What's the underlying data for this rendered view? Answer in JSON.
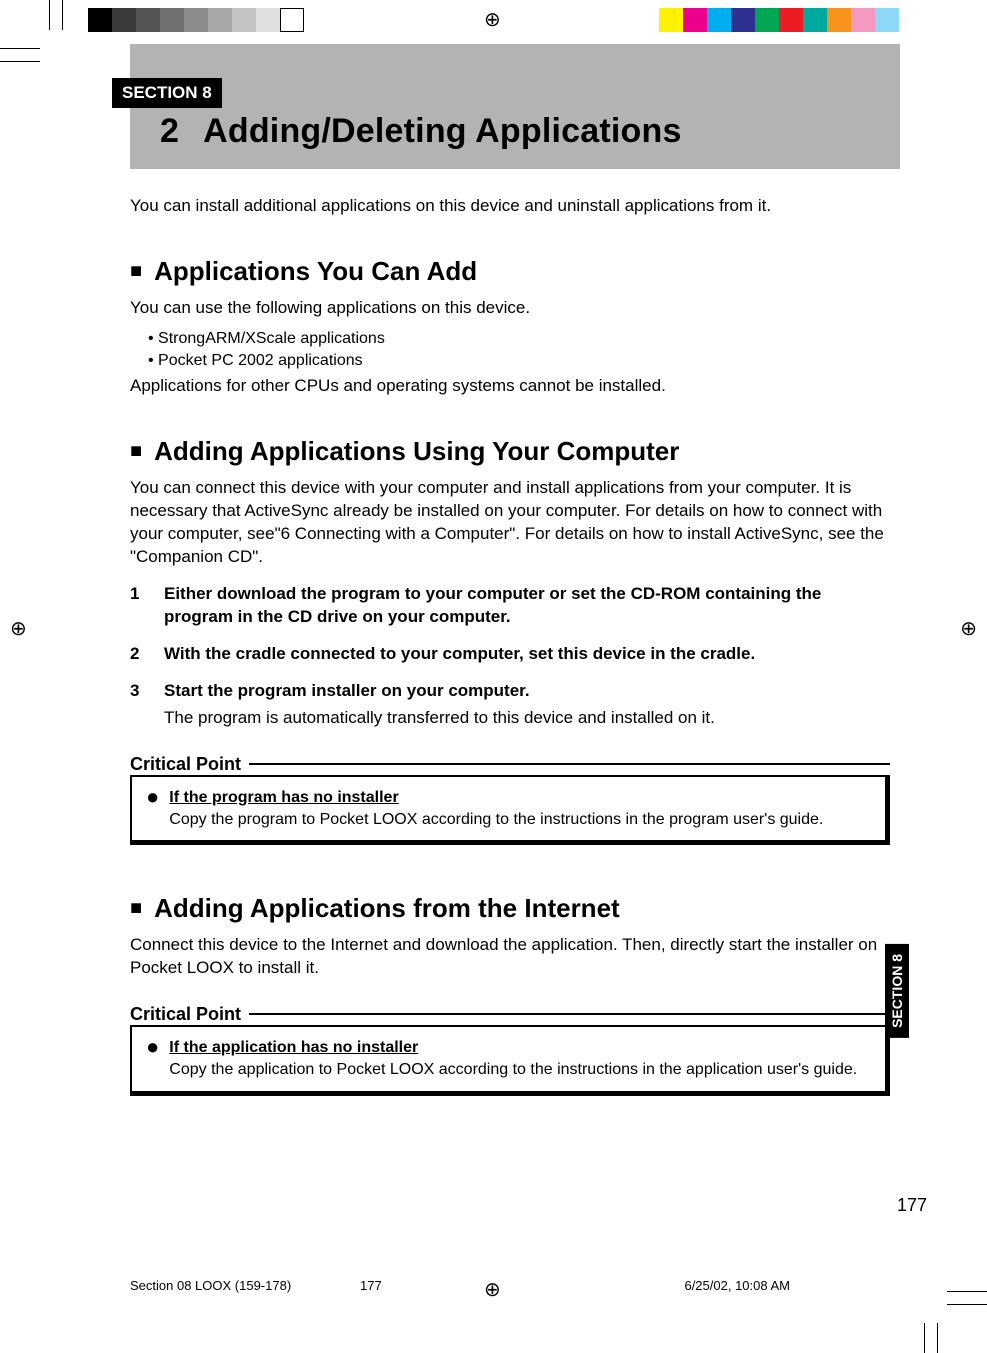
{
  "header": {
    "section_tag": "SECTION 8",
    "chapter_number": "2",
    "chapter_title": "Adding/Deleting Applications"
  },
  "intro": "You can install additional applications on this device and uninstall applications from it.",
  "sections": {
    "apps_add": {
      "heading": "Applications You Can Add",
      "lead": "You can use the following applications on this device.",
      "items": [
        "StrongARM/XScale applications",
        "Pocket PC 2002 applications"
      ],
      "tail": "Applications for other CPUs and operating systems cannot be installed."
    },
    "using_computer": {
      "heading": "Adding Applications Using Your Computer",
      "lead": "You can connect this device with your computer and install applications from your computer. It is necessary that ActiveSync already be installed on your computer. For details on how to connect with your computer, see\"6 Connecting with a Computer\". For details on how to install ActiveSync, see the \"Companion CD\".",
      "steps": [
        {
          "n": "1",
          "t": "Either download the program to your computer or set the CD-ROM containing the program in the CD drive on your computer."
        },
        {
          "n": "2",
          "t": "With the cradle connected to your computer, set this device in the cradle."
        },
        {
          "n": "3",
          "t": "Start the program installer on your computer."
        }
      ],
      "step3_note": "The program is automatically transferred to this device and installed on it.",
      "critical_label": "Critical Point",
      "critical_heading": "If the program has no installer",
      "critical_body": "Copy the program to Pocket LOOX according to the instructions in the program user's guide."
    },
    "from_internet": {
      "heading": "Adding Applications from the Internet",
      "lead": "Connect this device to the Internet and download the application. Then, directly start the installer on Pocket LOOX to install it.",
      "critical_label": "Critical Point",
      "critical_heading": "If the application has no installer",
      "critical_body": "Copy the application to Pocket LOOX according to the instructions in the application user's guide."
    }
  },
  "side_tab": "SECTION 8",
  "page_number": "177",
  "footer": {
    "left": "Section 08 LOOX (159-178)",
    "center": "177",
    "right": "6/25/02, 10:08 AM"
  },
  "colorbar_left": [
    "#000000",
    "#3a3a3a",
    "#555555",
    "#707070",
    "#8c8c8c",
    "#a8a8a8",
    "#c4c4c4",
    "#e0e0e0",
    "#ffffff"
  ],
  "colorbar_right": [
    "#fff200",
    "#ec008c",
    "#00aeef",
    "#2e3192",
    "#00a651",
    "#ed1c24",
    "#00a99d",
    "#f7941d",
    "#f49ac1",
    "#8dd7f7"
  ]
}
